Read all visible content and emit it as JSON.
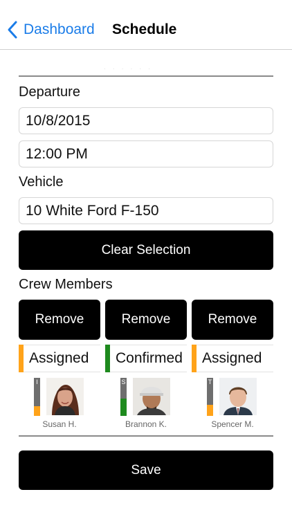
{
  "nav": {
    "back_label": "Dashboard",
    "title": "Schedule"
  },
  "form": {
    "departure_label": "Departure",
    "date_value": "10/8/2015",
    "time_value": "12:00 PM",
    "vehicle_label": "Vehicle",
    "vehicle_value": "10 White Ford F-150",
    "clear_label": "Clear Selection",
    "crew_label": "Crew Members"
  },
  "crew": [
    {
      "remove_label": "Remove",
      "status": "Assigned",
      "status_color": "#ffa31a",
      "initial": "I",
      "name": "Susan H.",
      "progress": 0.25,
      "progress_color": "#ffa31a"
    },
    {
      "remove_label": "Remove",
      "status": "Confirmed",
      "status_color": "#1e8a1e",
      "initial": "S",
      "name": "Brannon K.",
      "progress": 0.45,
      "progress_color": "#1e8a1e"
    },
    {
      "remove_label": "Remove",
      "status": "Assigned",
      "status_color": "#ffa31a",
      "initial": "T",
      "name": "Spencer M.",
      "progress": 0.3,
      "progress_color": "#ffa31a"
    }
  ],
  "save_label": "Save",
  "colors": {
    "accent": "#1a7ce8",
    "assigned": "#ffa31a",
    "confirmed": "#1e8a1e"
  }
}
